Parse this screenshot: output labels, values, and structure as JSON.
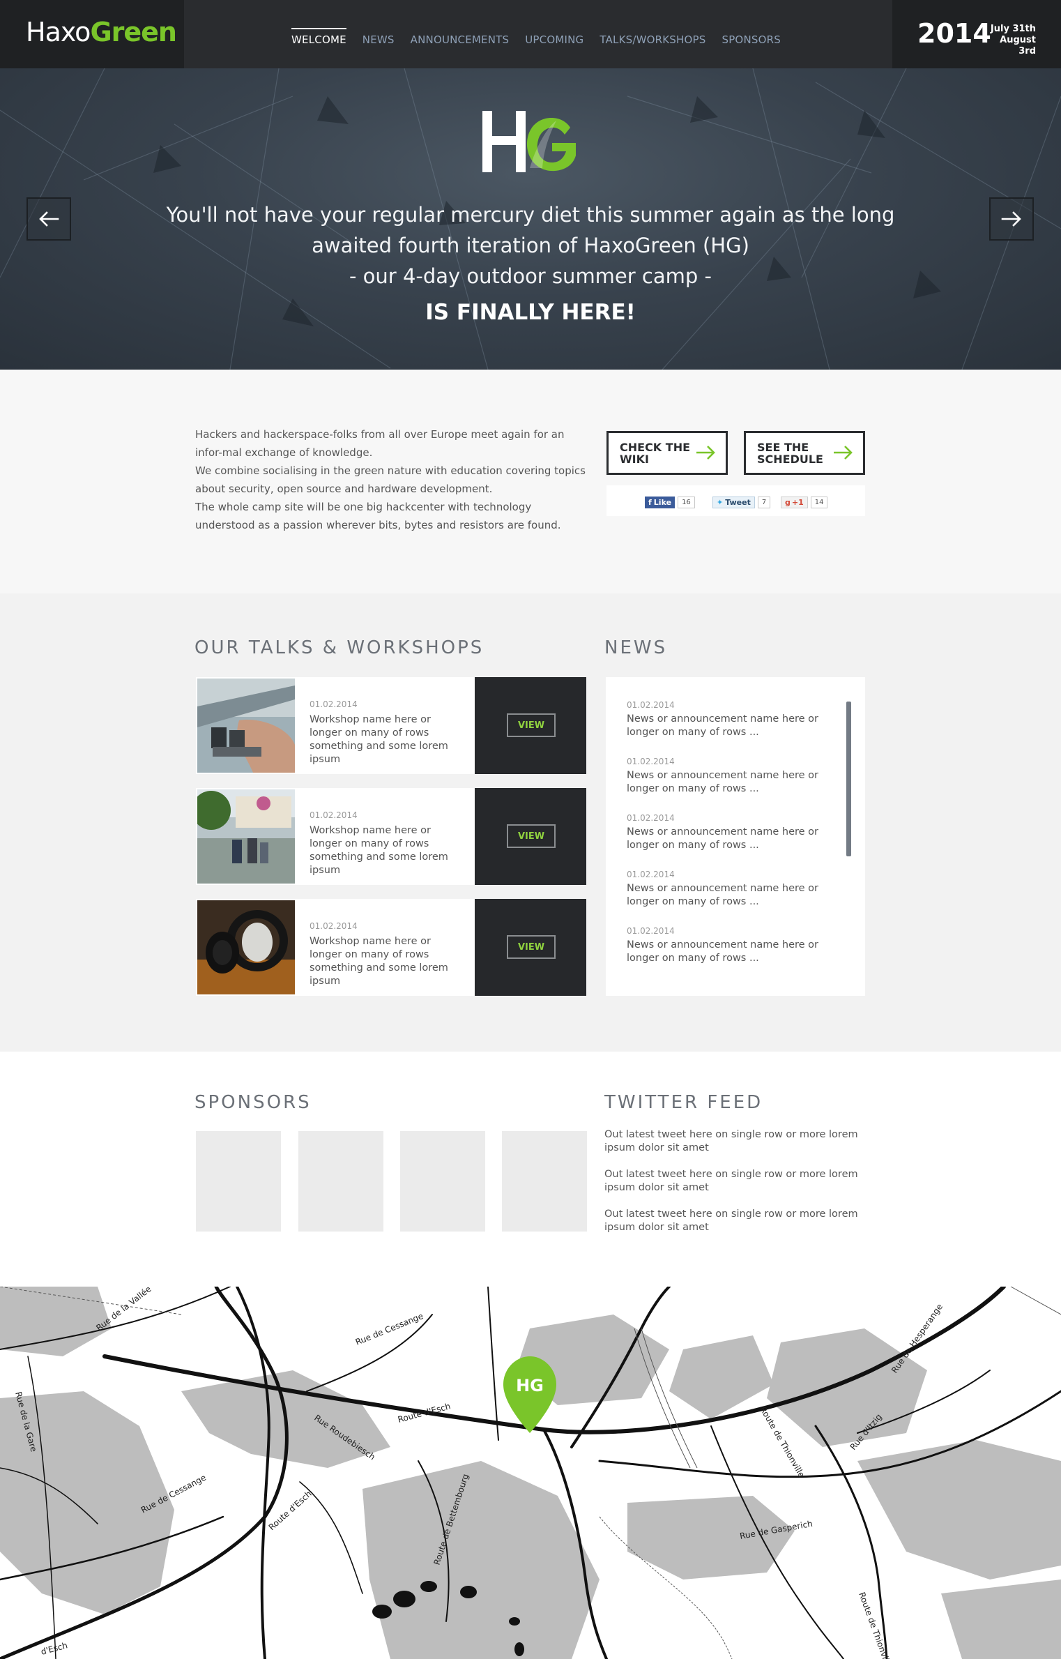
{
  "header": {
    "logo_white": "Haxo",
    "logo_green": "Green",
    "nav": [
      {
        "label": "WELCOME",
        "active": true
      },
      {
        "label": "NEWS"
      },
      {
        "label": "ANNOUNCEMENTS"
      },
      {
        "label": "UPCOMING"
      },
      {
        "label": "TALKS/WORKSHOPS"
      },
      {
        "label": "SPONSORS"
      }
    ],
    "year": "2014",
    "date_start": "July 31th",
    "date_end": "August 3rd"
  },
  "hero": {
    "logo_letters": "HG",
    "line1": "You'll not have your regular mercury diet this summer again as the long",
    "line2": "awaited fourth iteration of HaxoGreen (HG)",
    "line3": "- our 4-day outdoor summer camp -",
    "big": "IS FINALLY HERE!",
    "prev_icon": "arrow-left-icon",
    "next_icon": "arrow-right-icon"
  },
  "intro": {
    "p1": "Hackers and hackerspace-folks from all over Europe meet again for an infor-mal exchange of knowledge.",
    "p2": "We combine socialising in the green nature with education covering topics about security, open source and hardware development.",
    "p3": "The whole camp site will be one big hackcenter with technology understood as a passion wherever bits, bytes and resistors are found.",
    "cta1": "CHECK THE WIKI",
    "cta2": "SEE THE SCHEDULE",
    "social": {
      "fb_label": "Like",
      "fb_count": "16",
      "tw_label": "Tweet",
      "tw_count": "7",
      "gp_label": "+1",
      "gp_count": "14"
    }
  },
  "talks": {
    "title": "OUR TALKS & WORKSHOPS",
    "view_label": "VIEW",
    "items": [
      {
        "date": "01.02.2014",
        "name": "Workshop name here or longer on many of rows something and some lorem ipsum"
      },
      {
        "date": "01.02.2014",
        "name": "Workshop name here or longer on many of rows something and some lorem ipsum"
      },
      {
        "date": "01.02.2014",
        "name": "Workshop name here or longer on many of rows something and some lorem ipsum"
      }
    ]
  },
  "news": {
    "title": "NEWS",
    "items": [
      {
        "date": "01.02.2014",
        "text": "News or announcement name here or longer on many of rows ..."
      },
      {
        "date": "01.02.2014",
        "text": "News or announcement name here or longer on many of rows ..."
      },
      {
        "date": "01.02.2014",
        "text": "News or announcement name here or longer on many of rows ..."
      },
      {
        "date": "01.02.2014",
        "text": "News or announcement name here or longer on many of rows ..."
      },
      {
        "date": "01.02.2014",
        "text": "News or announcement name here or longer on many of rows ..."
      }
    ]
  },
  "sponsors": {
    "title": "SPONSORS",
    "count": 4
  },
  "twitter": {
    "title": "TWITTER FEED",
    "tweets": [
      "Out latest tweet here on single row or more lorem ipsum dolor sit amet",
      "Out latest tweet here on single row or more lorem ipsum dolor sit amet",
      "Out latest tweet here on single row or more lorem ipsum dolor sit amet"
    ]
  },
  "map": {
    "marker_label": "HG",
    "streets": [
      "Rue de la Vallée",
      "Rue de Cessange",
      "Rue de la Gare",
      "Rue Roudebiesch",
      "Route d'Esch",
      "Rue de Cessange",
      "Route d'Esch",
      "Route de Bettembourg",
      "Route de Thionville",
      "Rue de Hesperange",
      "Rue d'Itzig",
      "Rue de Gasperich",
      "Route de Thionville",
      "d'Esch"
    ]
  },
  "colors": {
    "accent": "#7ac52a",
    "dark": "#2a2c2f",
    "text": "#555555"
  }
}
